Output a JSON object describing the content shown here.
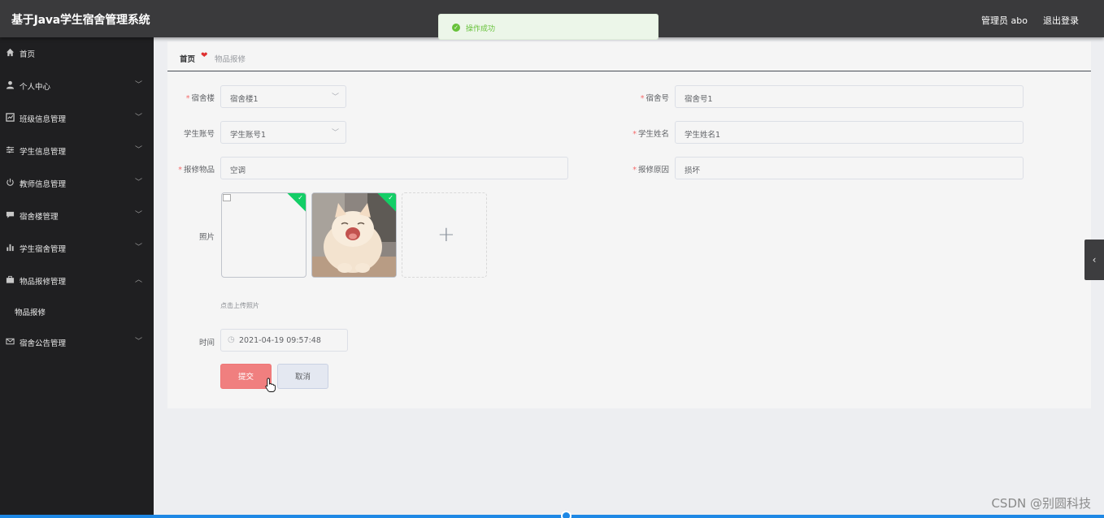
{
  "header": {
    "app_title": "基于Java学生宿舍管理系统",
    "admin_label": "管理员 abo",
    "logout": "退出登录"
  },
  "toast": {
    "message": "操作成功",
    "icon": "check-circle-icon"
  },
  "sidebar": {
    "items": [
      {
        "label": "首页",
        "icon": "home-icon"
      },
      {
        "label": "个人中心",
        "icon": "user-icon"
      },
      {
        "label": "班级信息管理",
        "icon": "chart-icon"
      },
      {
        "label": "学生信息管理",
        "icon": "sliders-icon"
      },
      {
        "label": "教师信息管理",
        "icon": "power-icon"
      },
      {
        "label": "宿舍楼管理",
        "icon": "chat-icon"
      },
      {
        "label": "学生宿舍管理",
        "icon": "bar-chart-icon"
      },
      {
        "label": "物品报修管理",
        "icon": "briefcase-icon"
      },
      {
        "label": "宿舍公告管理",
        "icon": "mail-icon"
      }
    ],
    "sub_item": "物品报修"
  },
  "breadcrumb": {
    "home": "首页",
    "current": "物品报修"
  },
  "form": {
    "building_label": "宿舍楼",
    "building_value": "宿舍楼1",
    "room_label": "宿舍号",
    "room_value": "宿舍号1",
    "account_label": "学生账号",
    "account_value": "学生账号1",
    "name_label": "学生姓名",
    "name_value": "学生姓名1",
    "item_label": "报修物品",
    "item_value": "空调",
    "reason_label": "报修原因",
    "reason_value": "损坏",
    "photo_label": "照片",
    "upload_hint": "点击上传照片",
    "time_label": "时间",
    "time_value": "2021-04-19 09:57:48",
    "submit": "提交",
    "cancel": "取消"
  },
  "watermark": "CSDN @别圆科技",
  "colors": {
    "success": "#67c23a",
    "submit": "#f07f7f",
    "accent": "#1e88e5"
  }
}
